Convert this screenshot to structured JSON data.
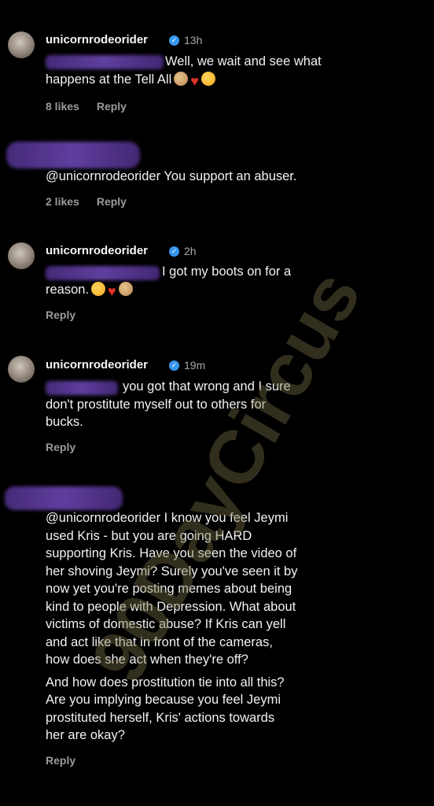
{
  "comments": [
    {
      "username": "unicornrodeorider",
      "time": "13h",
      "lines": [
        "Well, we wait and see what",
        "happens at the Tell All"
      ],
      "likes": "8 likes",
      "reply": "Reply"
    },
    {
      "username": "",
      "lines": [
        "@unicornrodeorider You support an abuser."
      ],
      "likes": "2 likes",
      "reply": "Reply"
    },
    {
      "username": "unicornrodeorider",
      "time": "2h",
      "lines": [
        "I got my boots on for a",
        "reason."
      ],
      "reply": "Reply"
    },
    {
      "username": "unicornrodeorider",
      "time": "19m",
      "lines": [
        "you got that wrong and I sure",
        "don't prostitute  myself out to others for",
        "bucks."
      ],
      "reply": "Reply"
    },
    {
      "username": "",
      "lines": [
        "@unicornrodeorider I know you feel Jeymi",
        "used Kris - but you are going HARD",
        "supporting Kris. Have you seen the video of",
        "her shoving Jeymi? Surely you've seen it by",
        "now yet you're posting memes about being",
        "kind to people with Depression. What about",
        "victims of domestic abuse? If Kris can yell",
        "and act like that in front of the cameras,",
        "how does she act when they're off?",
        "And how does prostitution tie into all this?",
        "Are you implying because you feel Jeymi",
        "prostituted herself, Kris' actions towards",
        "her are okay?"
      ],
      "reply": "Reply"
    }
  ],
  "watermark": "90DayCircus",
  "colors": {
    "background": "#000000",
    "verified": "#3797f0",
    "redaction": "#5a3a9a"
  }
}
